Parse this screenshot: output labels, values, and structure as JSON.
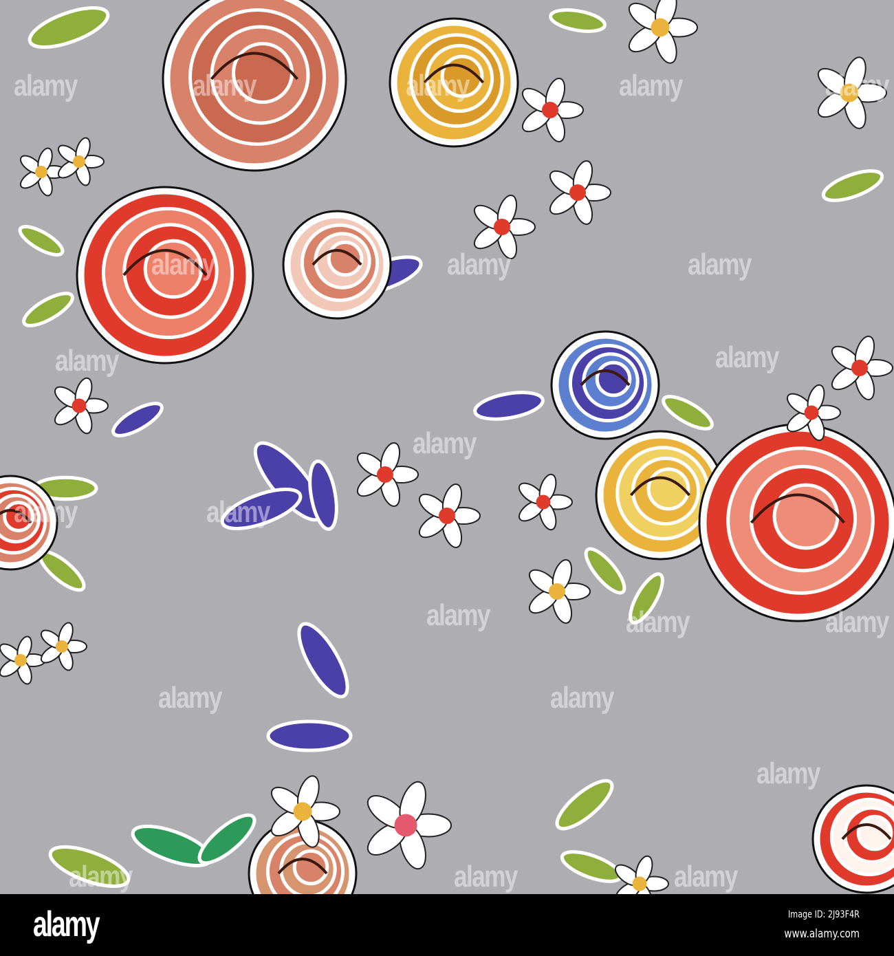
{
  "image": {
    "watermark_text": "alamy",
    "background_color": "#aeadb2",
    "palette": {
      "salmon": "#d9826a",
      "red": "#e03a2c",
      "yellow": "#e9b33c",
      "purple": "#4b3fa8",
      "green": "#8fae3c",
      "white": "#ffffff"
    }
  },
  "footer": {
    "logo": "alamy",
    "image_id": "Image ID: 2J93F4R",
    "website": "www.alamy.com"
  }
}
